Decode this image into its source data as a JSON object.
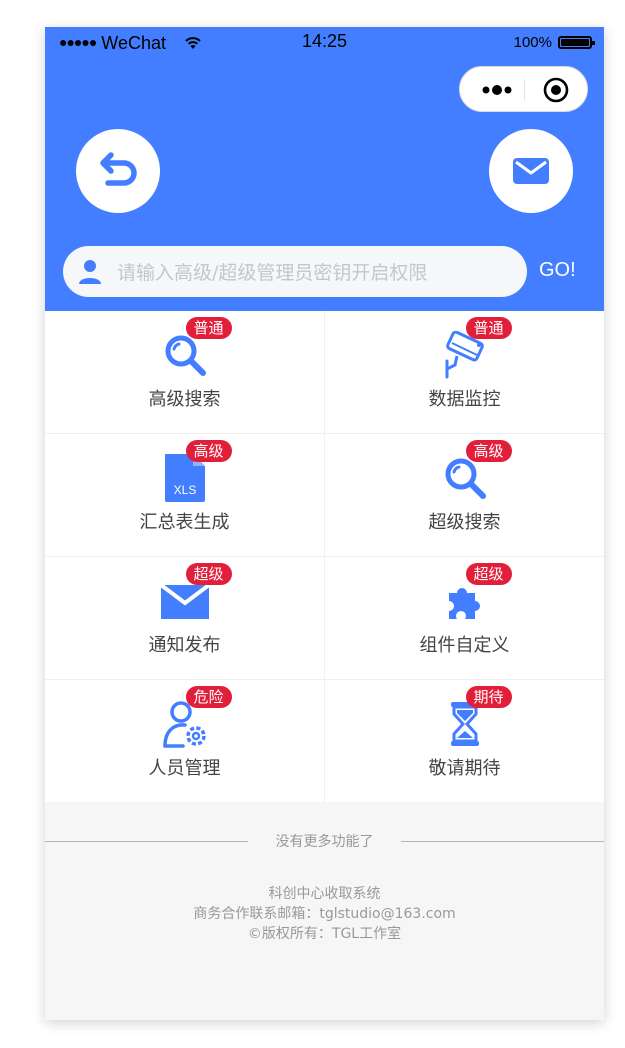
{
  "status_bar": {
    "carrier": "WeChat",
    "time": "14:25",
    "battery": "100%"
  },
  "header": {
    "search": {
      "placeholder": "请输入高级/超级管理员密钥开启权限",
      "value": ""
    },
    "go_label": "GO!"
  },
  "grid": [
    {
      "label": "高级搜索",
      "badge": "普通",
      "icon": "search-icon"
    },
    {
      "label": "数据监控",
      "badge": "普通",
      "icon": "cctv-camera-icon"
    },
    {
      "label": "汇总表生成",
      "badge": "高级",
      "icon": "xls-file-icon",
      "icon_text": "XLS"
    },
    {
      "label": "超级搜索",
      "badge": "高级",
      "icon": "search-icon"
    },
    {
      "label": "通知发布",
      "badge": "超级",
      "icon": "envelope-icon"
    },
    {
      "label": "组件自定义",
      "badge": "超级",
      "icon": "puzzle-icon"
    },
    {
      "label": "人员管理",
      "badge": "危险",
      "icon": "user-settings-icon"
    },
    {
      "label": "敬请期待",
      "badge": "期待",
      "icon": "hourglass-icon"
    }
  ],
  "no_more_text": "没有更多功能了",
  "footer": {
    "line1": "科创中心收取系统",
    "line2": "商务合作联系邮箱：tglstudio@163.com",
    "line3": "©版权所有：TGL工作室"
  },
  "colors": {
    "primary": "#427eff",
    "badge": "#e21f3a",
    "background": "#f6f6f6"
  }
}
